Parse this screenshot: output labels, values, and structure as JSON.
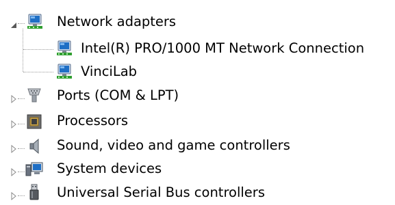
{
  "tree": {
    "items": [
      {
        "label": "Network adapters",
        "expanded": true,
        "icon": "network-adapter-icon"
      },
      {
        "label": "Intel(R) PRO/1000 MT Network Connection",
        "icon": "network-adapter-icon"
      },
      {
        "label": "VinciLab",
        "icon": "network-adapter-icon"
      },
      {
        "label": "Ports (COM & LPT)",
        "expanded": false,
        "icon": "port-connector-icon"
      },
      {
        "label": "Processors",
        "expanded": false,
        "icon": "processor-chip-icon"
      },
      {
        "label": "Sound, video and game controllers",
        "expanded": false,
        "icon": "speaker-icon"
      },
      {
        "label": "System devices",
        "expanded": false,
        "icon": "system-devices-icon"
      },
      {
        "label": "Universal Serial Bus controllers",
        "expanded": false,
        "icon": "usb-plug-icon"
      }
    ]
  },
  "colors": {
    "treeline": "#9a9a9a",
    "expander": "#595959",
    "monitor_blue": "#1f6fc5",
    "network_green": "#2f9e2f"
  }
}
